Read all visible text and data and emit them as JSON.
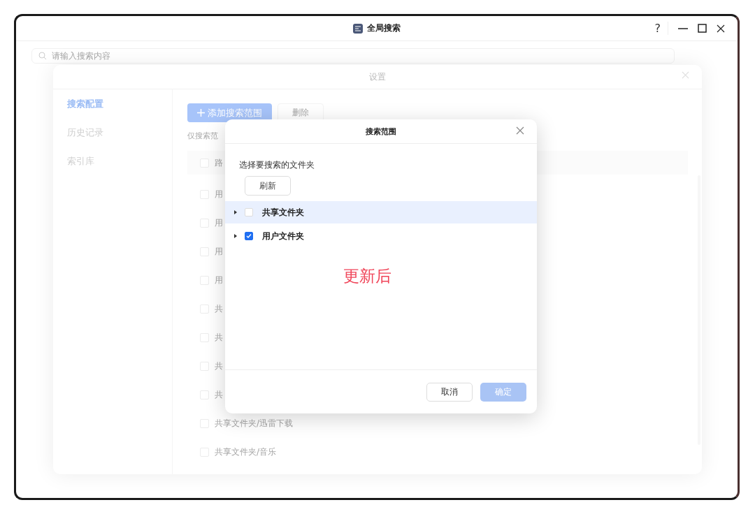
{
  "window": {
    "title": "全局搜索",
    "help": "?"
  },
  "search": {
    "placeholder": "请输入搜索内容"
  },
  "settings": {
    "title": "设置",
    "nav": [
      {
        "label": "搜索配置",
        "selected": true
      },
      {
        "label": "历史记录",
        "selected": false
      },
      {
        "label": "索引库",
        "selected": false
      }
    ],
    "add_button": "添加搜索范围",
    "delete_button": {
      "label": "删除",
      "disabled": true
    },
    "note": "仅搜索范",
    "table": {
      "header": {
        "label": "路",
        "checked": false
      },
      "rows": [
        {
          "label": "用",
          "checked": false
        },
        {
          "label": "用",
          "checked": false
        },
        {
          "label": "用",
          "checked": false
        },
        {
          "label": "用",
          "checked": false
        },
        {
          "label": "共",
          "checked": false
        },
        {
          "label": "共",
          "checked": false
        },
        {
          "label": "共",
          "checked": false
        },
        {
          "label": "共",
          "checked": false
        },
        {
          "label": "共享文件夹/迅雷下载",
          "checked": false
        },
        {
          "label": "共享文件夹/音乐",
          "checked": false
        }
      ]
    }
  },
  "dialog": {
    "title": "搜索范围",
    "prompt": "选择要搜索的文件夹",
    "refresh": "刷新",
    "folders": [
      {
        "label": "共享文件夹",
        "checked": false,
        "selected": true,
        "expanded": false
      },
      {
        "label": "用户文件夹",
        "checked": true,
        "selected": false,
        "expanded": false
      }
    ],
    "annotation": "更新后",
    "cancel": "取消",
    "confirm": {
      "label": "确定",
      "disabled": true
    }
  }
}
